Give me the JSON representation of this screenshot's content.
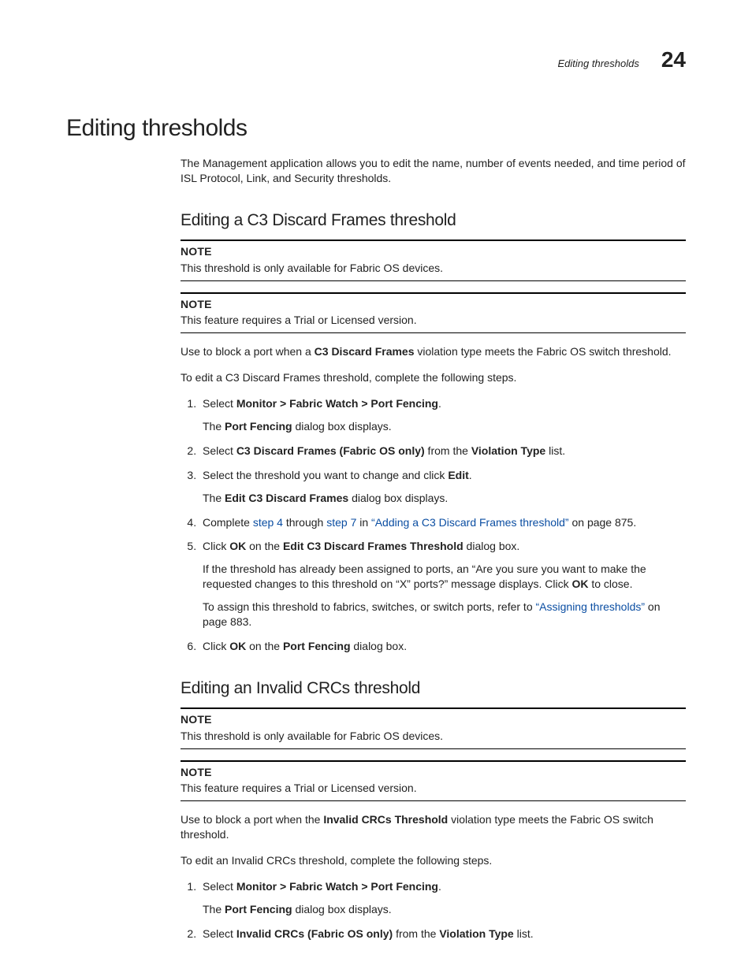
{
  "header": {
    "section_title": "Editing thresholds",
    "chapter_number": "24"
  },
  "h1": "Editing thresholds",
  "intro": "The Management application allows you to edit the name, number of events needed, and time period of ISL Protocol, Link, and Security thresholds.",
  "s1": {
    "heading": "Editing a C3 Discard Frames threshold",
    "note1_label": "NOTE",
    "note1_text": "This threshold is only available for Fabric OS devices.",
    "note2_label": "NOTE",
    "note2_text": "This feature requires a Trial or Licensed version.",
    "p1_a": "Use to block a port when a ",
    "p1_b": "C3 Discard Frames",
    "p1_c": " violation type meets the Fabric OS switch threshold.",
    "p2": "To edit a C3 Discard Frames threshold, complete the following steps.",
    "step1_a": "Select ",
    "step1_b": "Monitor > Fabric Watch > Port Fencing",
    "step1_c": ".",
    "step1_sub_a": "The ",
    "step1_sub_b": "Port Fencing",
    "step1_sub_c": " dialog box displays.",
    "step2_a": "Select ",
    "step2_b": "C3 Discard Frames (Fabric OS only)",
    "step2_c": " from the ",
    "step2_d": "Violation Type",
    "step2_e": " list.",
    "step3_a": "Select the threshold you want to change and click ",
    "step3_b": "Edit",
    "step3_c": ".",
    "step3_sub_a": "The ",
    "step3_sub_b": "Edit C3 Discard Frames",
    "step3_sub_c": " dialog box displays.",
    "step4_a": "Complete ",
    "step4_link1": "step 4",
    "step4_b": " through ",
    "step4_link2": "step 7",
    "step4_c": " in ",
    "step4_link3": "“Adding a C3 Discard Frames threshold”",
    "step4_d": " on page 875.",
    "step5_a": "Click ",
    "step5_b": "OK",
    "step5_c": " on the ",
    "step5_d": "Edit C3 Discard Frames Threshold",
    "step5_e": " dialog box.",
    "step5_sub1_a": "If the threshold has already been assigned to ports, an “Are you sure you want to make the requested changes to this threshold on “X” ports?” message displays. Click ",
    "step5_sub1_b": "OK",
    "step5_sub1_c": " to close.",
    "step5_sub2_a": "To assign this threshold to fabrics, switches, or switch ports, refer to ",
    "step5_sub2_link": "“Assigning thresholds”",
    "step5_sub2_b": " on page 883.",
    "step6_a": "Click ",
    "step6_b": "OK",
    "step6_c": " on the ",
    "step6_d": "Port Fencing",
    "step6_e": " dialog box."
  },
  "s2": {
    "heading": "Editing an Invalid CRCs threshold",
    "note1_label": "NOTE",
    "note1_text": "This threshold is only available for Fabric OS devices.",
    "note2_label": "NOTE",
    "note2_text": "This feature requires a Trial or Licensed version.",
    "p1_a": "Use to block a port when the ",
    "p1_b": "Invalid CRCs Threshold",
    "p1_c": " violation type meets the Fabric OS switch threshold.",
    "p2": "To edit an Invalid CRCs threshold, complete the following steps.",
    "step1_a": "Select ",
    "step1_b": "Monitor > Fabric Watch > Port Fencing",
    "step1_c": ".",
    "step1_sub_a": "The ",
    "step1_sub_b": "Port Fencing",
    "step1_sub_c": " dialog box displays.",
    "step2_a": "Select ",
    "step2_b": "Invalid CRCs (Fabric OS only)",
    "step2_c": " from the ",
    "step2_d": "Violation Type",
    "step2_e": " list."
  }
}
